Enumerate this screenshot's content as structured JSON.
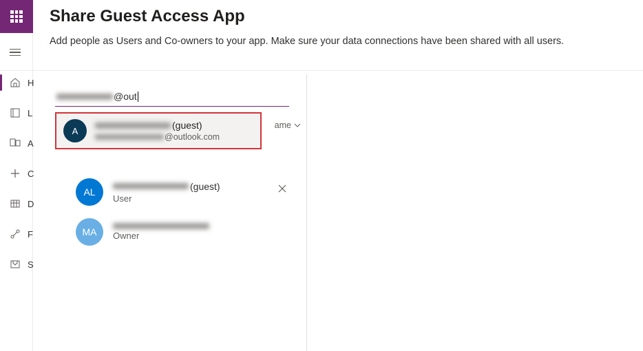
{
  "header": {
    "title": "Share Guest Access App",
    "subtitle": "Add people as Users and Co-owners to your app. Make sure your data connections have been shared with all users."
  },
  "nav": {
    "items": [
      {
        "letter": "H",
        "icon": "home"
      },
      {
        "letter": "L",
        "icon": "learn"
      },
      {
        "letter": "A",
        "icon": "apps"
      },
      {
        "letter": "C",
        "icon": "create"
      },
      {
        "letter": "D",
        "icon": "data"
      },
      {
        "letter": "F",
        "icon": "flows"
      },
      {
        "letter": "S",
        "icon": "solutions"
      }
    ]
  },
  "search": {
    "value_suffix": "@out"
  },
  "sort": {
    "label_fragment": "ame"
  },
  "suggestion": {
    "avatar_initials": "A",
    "name_suffix": " (guest)",
    "email_suffix": "@outlook.com"
  },
  "people": [
    {
      "avatar_initials": "AL",
      "avatar_style": "blue",
      "name_suffix": " (guest)",
      "role": "User",
      "removable": true
    },
    {
      "avatar_initials": "MA",
      "avatar_style": "light",
      "name_suffix": "",
      "role": "Owner",
      "removable": false
    }
  ]
}
